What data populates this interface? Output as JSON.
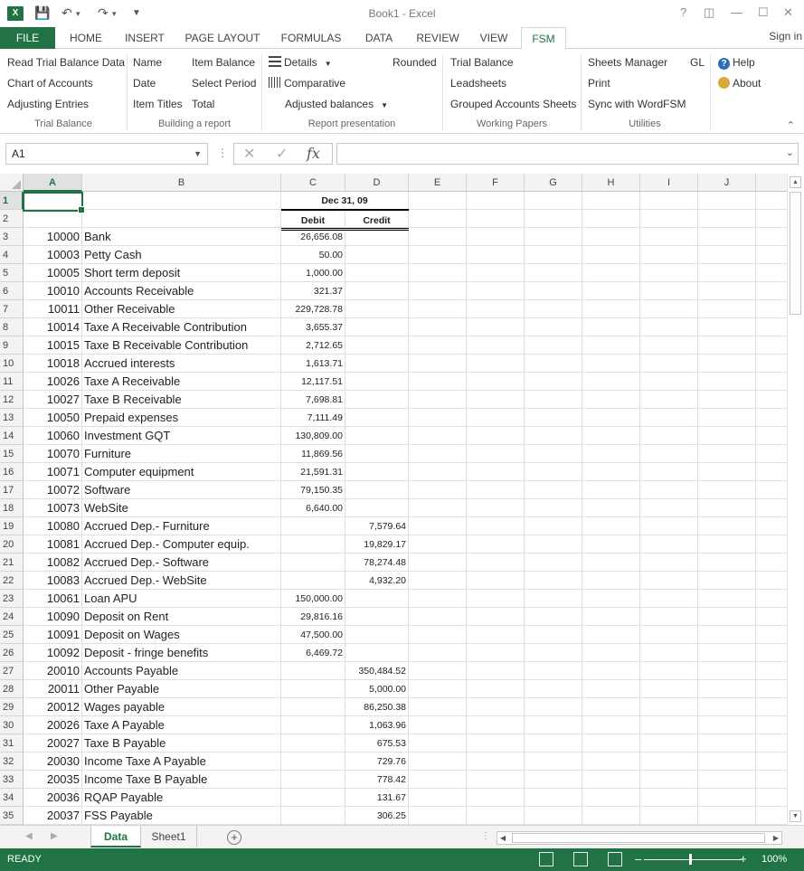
{
  "window": {
    "title": "Book1 - Excel",
    "app_icon_text": "X",
    "help": "?",
    "signin": "Sign in"
  },
  "tabs": [
    "FILE",
    "HOME",
    "INSERT",
    "PAGE LAYOUT",
    "FORMULAS",
    "DATA",
    "REVIEW",
    "VIEW",
    "FSM"
  ],
  "active_tab": "FSM",
  "ribbon": {
    "groups": {
      "trial_balance": {
        "label": "Trial Balance",
        "items": [
          "Read Trial Balance Data",
          "Chart of Accounts",
          "Adjusting Entries"
        ]
      },
      "building": {
        "label": "Building a report",
        "col1": [
          "Name",
          "Date",
          "Item Titles"
        ],
        "col2": [
          "Item Balance",
          "Select Period",
          "Total"
        ]
      },
      "presentation": {
        "label": "Report presentation",
        "details": "Details",
        "comparative": "Comparative",
        "adjusted": "Adjusted balances",
        "rounded": "Rounded"
      },
      "working_papers": {
        "label": "Working Papers",
        "items": [
          "Trial Balance",
          "Leadsheets",
          "Grouped Accounts Sheets"
        ]
      },
      "utilities": {
        "label": "Utilities",
        "items": [
          "Sheets Manager",
          "Print",
          "Sync with WordFSM"
        ],
        "gl": "GL"
      },
      "help": {
        "help": "Help",
        "about": "About"
      }
    }
  },
  "formula_bar": {
    "name_box": "A1",
    "fx": "fx",
    "value": ""
  },
  "columns": [
    "A",
    "B",
    "C",
    "D",
    "E",
    "F",
    "G",
    "H",
    "I",
    "J",
    ""
  ],
  "header_rows": {
    "date": "Dec 31, 09",
    "debit": "Debit",
    "credit": "Credit"
  },
  "rows": [
    {
      "n": "1",
      "a": "",
      "b": "",
      "c": "",
      "d": ""
    },
    {
      "n": "2",
      "a": "",
      "b": "",
      "c": "",
      "d": ""
    },
    {
      "n": "3",
      "a": "10000",
      "b": "Bank",
      "c": "26,656.08",
      "d": ""
    },
    {
      "n": "4",
      "a": "10003",
      "b": "Petty Cash",
      "c": "50.00",
      "d": ""
    },
    {
      "n": "5",
      "a": "10005",
      "b": "Short term deposit",
      "c": "1,000.00",
      "d": ""
    },
    {
      "n": "6",
      "a": "10010",
      "b": "Accounts Receivable",
      "c": "321.37",
      "d": ""
    },
    {
      "n": "7",
      "a": "10011",
      "b": "Other Receivable",
      "c": "229,728.78",
      "d": ""
    },
    {
      "n": "8",
      "a": "10014",
      "b": "Taxe A Receivable Contribution",
      "c": "3,655.37",
      "d": ""
    },
    {
      "n": "9",
      "a": "10015",
      "b": "Taxe B Receivable Contribution",
      "c": "2,712.65",
      "d": ""
    },
    {
      "n": "10",
      "a": "10018",
      "b": "Accrued interests",
      "c": "1,613.71",
      "d": ""
    },
    {
      "n": "11",
      "a": "10026",
      "b": "Taxe A Receivable",
      "c": "12,117.51",
      "d": ""
    },
    {
      "n": "12",
      "a": "10027",
      "b": "Taxe B Receivable",
      "c": "7,698.81",
      "d": ""
    },
    {
      "n": "13",
      "a": "10050",
      "b": "Prepaid expenses",
      "c": "7,111.49",
      "d": ""
    },
    {
      "n": "14",
      "a": "10060",
      "b": "Investment GQT",
      "c": "130,809.00",
      "d": ""
    },
    {
      "n": "15",
      "a": "10070",
      "b": "Furniture",
      "c": "11,869.56",
      "d": ""
    },
    {
      "n": "16",
      "a": "10071",
      "b": "Computer equipment",
      "c": "21,591.31",
      "d": ""
    },
    {
      "n": "17",
      "a": "10072",
      "b": "Software",
      "c": "79,150.35",
      "d": ""
    },
    {
      "n": "18",
      "a": "10073",
      "b": "WebSite",
      "c": "6,640.00",
      "d": ""
    },
    {
      "n": "19",
      "a": "10080",
      "b": "Accrued Dep.- Furniture",
      "c": "",
      "d": "7,579.64"
    },
    {
      "n": "20",
      "a": "10081",
      "b": "Accrued Dep.- Computer equip.",
      "c": "",
      "d": "19,829.17"
    },
    {
      "n": "21",
      "a": "10082",
      "b": "Accrued Dep.- Software",
      "c": "",
      "d": "78,274.48"
    },
    {
      "n": "22",
      "a": "10083",
      "b": "Accrued Dep.- WebSite",
      "c": "",
      "d": "4,932.20"
    },
    {
      "n": "23",
      "a": "10061",
      "b": "Loan APU",
      "c": "150,000.00",
      "d": ""
    },
    {
      "n": "24",
      "a": "10090",
      "b": "Deposit on Rent",
      "c": "29,816.16",
      "d": ""
    },
    {
      "n": "25",
      "a": "10091",
      "b": "Deposit on Wages",
      "c": "47,500.00",
      "d": ""
    },
    {
      "n": "26",
      "a": "10092",
      "b": "Deposit - fringe benefits",
      "c": "6,469.72",
      "d": ""
    },
    {
      "n": "27",
      "a": "20010",
      "b": "Accounts Payable",
      "c": "",
      "d": "350,484.52"
    },
    {
      "n": "28",
      "a": "20011",
      "b": "Other Payable",
      "c": "",
      "d": "5,000.00"
    },
    {
      "n": "29",
      "a": "20012",
      "b": "Wages payable",
      "c": "",
      "d": "86,250.38"
    },
    {
      "n": "30",
      "a": "20026",
      "b": "Taxe A Payable",
      "c": "",
      "d": "1,063.96"
    },
    {
      "n": "31",
      "a": "20027",
      "b": "Taxe B Payable",
      "c": "",
      "d": "675.53"
    },
    {
      "n": "32",
      "a": "20030",
      "b": "Income Taxe A Payable",
      "c": "",
      "d": "729.76"
    },
    {
      "n": "33",
      "a": "20035",
      "b": "Income Taxe B Payable",
      "c": "",
      "d": "778.42"
    },
    {
      "n": "34",
      "a": "20036",
      "b": "RQAP Payable",
      "c": "",
      "d": "131.67"
    },
    {
      "n": "35",
      "a": "20037",
      "b": "FSS Payable",
      "c": "",
      "d": "306.25"
    }
  ],
  "sheets": [
    "Data",
    "Sheet1"
  ],
  "active_sheet": "Data",
  "status": {
    "ready": "READY",
    "zoom": "100%"
  },
  "colors": {
    "accent": "#217346"
  }
}
